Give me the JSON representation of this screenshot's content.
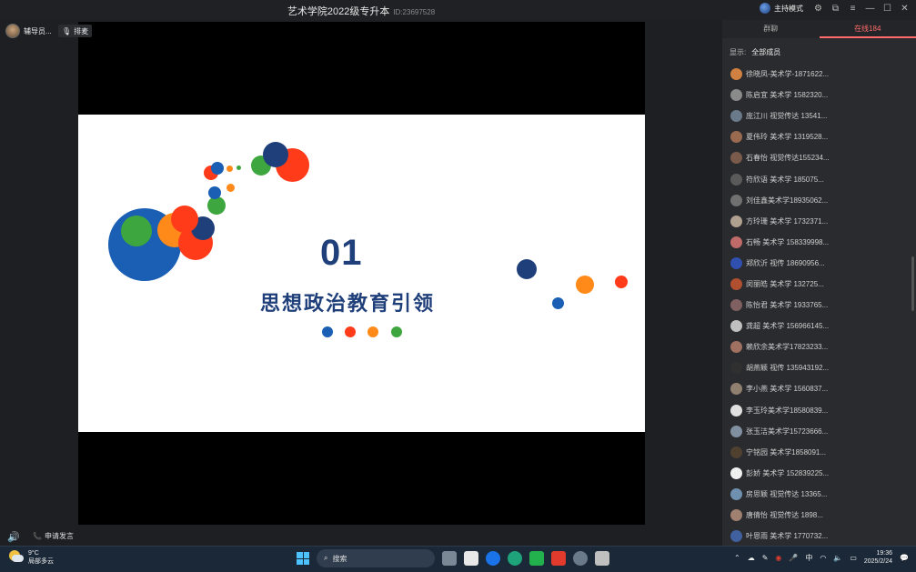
{
  "window": {
    "title": "艺术学院2022级专升本",
    "room_id": "ID:23697528",
    "host_mode_label": "主持模式"
  },
  "stage": {
    "teacher_name": "辅导员...",
    "mic_label": "排麦",
    "slide": {
      "number": "01",
      "title": "思想政治教育引领",
      "colors": {
        "navy": "#1f3f7a",
        "blue": "#1a5fb4",
        "orange": "#ff8a1a",
        "red": "#ff3b1a",
        "green": "#3ea63e"
      }
    },
    "apply_label": "申请发言"
  },
  "panel": {
    "tabs": [
      {
        "label": "群聊"
      },
      {
        "label": "在线184"
      }
    ],
    "filter_label": "显示:",
    "filter_value": "全部成员",
    "members": [
      {
        "name": "徐晓凤-美术学-1871622...",
        "color": "#d08040"
      },
      {
        "name": "陈启宜 美术学 1582320...",
        "color": "#8a8a8a"
      },
      {
        "name": "庞江川 视觉传达 13541...",
        "color": "#6a7a8a"
      },
      {
        "name": "夏伟玲 美术学 1319528...",
        "color": "#9a6a50"
      },
      {
        "name": "石春怡 视觉传达155234...",
        "color": "#7a5a4a"
      },
      {
        "name": "符欣语 美术学 185075...",
        "color": "#5a5a5a"
      },
      {
        "name": "刘佳鑫美术学18935062...",
        "color": "#707070"
      },
      {
        "name": "方玲珊 美术学 1732371...",
        "color": "#b0a090"
      },
      {
        "name": "石畅 美术学 158339998...",
        "color": "#c06a6a"
      },
      {
        "name": "郑欣沂 视传 18690956...",
        "color": "#3050b0"
      },
      {
        "name": "闵丽皓 美术学 132725...",
        "color": "#b05030"
      },
      {
        "name": "陈怡君 美术学 1933765...",
        "color": "#806060"
      },
      {
        "name": "龚超 美术学 156966145...",
        "color": "#c0c0c0"
      },
      {
        "name": "赖欣余美术学17823233...",
        "color": "#a07060"
      },
      {
        "name": "胡燕颖 视传 135943192...",
        "color": "#303030"
      },
      {
        "name": "李小燕 美术学 1560837...",
        "color": "#908070"
      },
      {
        "name": "李玉玲美术学18580839...",
        "color": "#e0e0e0"
      },
      {
        "name": "张玉洁美术学15723666...",
        "color": "#8090a0"
      },
      {
        "name": "宁铭园 美术学1858091...",
        "color": "#504030"
      },
      {
        "name": "彭娇 美术学 152839225...",
        "color": "#f0f0f0"
      },
      {
        "name": "房思颖 视觉传达 13365...",
        "color": "#7090b0"
      },
      {
        "name": "唐倩怡 视觉传达 1898...",
        "color": "#a08070"
      },
      {
        "name": "叶恩雨 美术学 1770732...",
        "color": "#4060a0"
      }
    ]
  },
  "taskbar": {
    "weather_temp": "9°C",
    "weather_desc": "局部多云",
    "weather_badge": "2",
    "search_placeholder": "搜索",
    "ime": "中",
    "time": "19:36",
    "date": "2025/2/24"
  }
}
